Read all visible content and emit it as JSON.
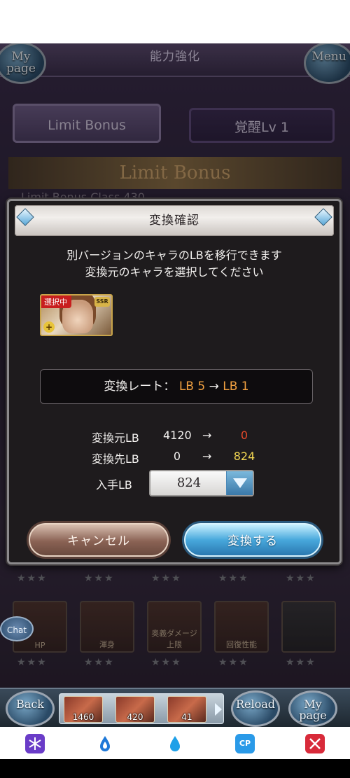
{
  "header": {
    "title": "能力強化",
    "my_page_label": "My page",
    "menu_label": "Menu"
  },
  "tabs": [
    {
      "label": "Limit Bonus"
    },
    {
      "label": "覚醒Lv 1"
    }
  ],
  "banner": {
    "title": "Limit Bonus",
    "class_text": "Limit Bonus Class 430"
  },
  "background_slots": {
    "captions": [
      "HP",
      "渾身",
      "奥義ダメージ上限",
      "回復性能"
    ]
  },
  "chat_label": "Chat",
  "modal": {
    "title": "変換確認",
    "message_lines": [
      "別バージョンのキャラのLBを移行できます",
      "変換元のキャラを選択してください"
    ],
    "character": {
      "selected_tag": "選択中",
      "rarity": "SSR"
    },
    "rate": {
      "label": "変換レート：",
      "from": "LB 5",
      "arrow": "→",
      "to": "LB 1"
    },
    "rows": [
      {
        "label": "変換元LB",
        "from": "4120",
        "arrow": "→",
        "to": "0",
        "to_color": "#e84a2a"
      },
      {
        "label": "変換先LB",
        "from": "0",
        "arrow": "→",
        "to": "824",
        "to_color": "#f2d652"
      }
    ],
    "obtain": {
      "label": "入手LB",
      "value": "824"
    },
    "cancel_label": "キャンセル",
    "confirm_label": "変換する"
  },
  "bottom_bar": {
    "back_label": "Back",
    "reload_label": "Reload",
    "my_page_label": "My page",
    "items": [
      {
        "count": "1460"
      },
      {
        "count": "420"
      },
      {
        "count": "41"
      }
    ]
  },
  "nav_icons": [
    {
      "name": "snowflake-icon",
      "color": "#6a3cc8"
    },
    {
      "name": "water-drop-outline-icon",
      "color": "#1e78d8"
    },
    {
      "name": "water-drop-icon",
      "color": "#1ea0e8"
    },
    {
      "name": "cp-icon",
      "color": "#2a9ae8",
      "label": "CP"
    },
    {
      "name": "crossed-swords-icon",
      "color": "#d82a3a"
    }
  ]
}
